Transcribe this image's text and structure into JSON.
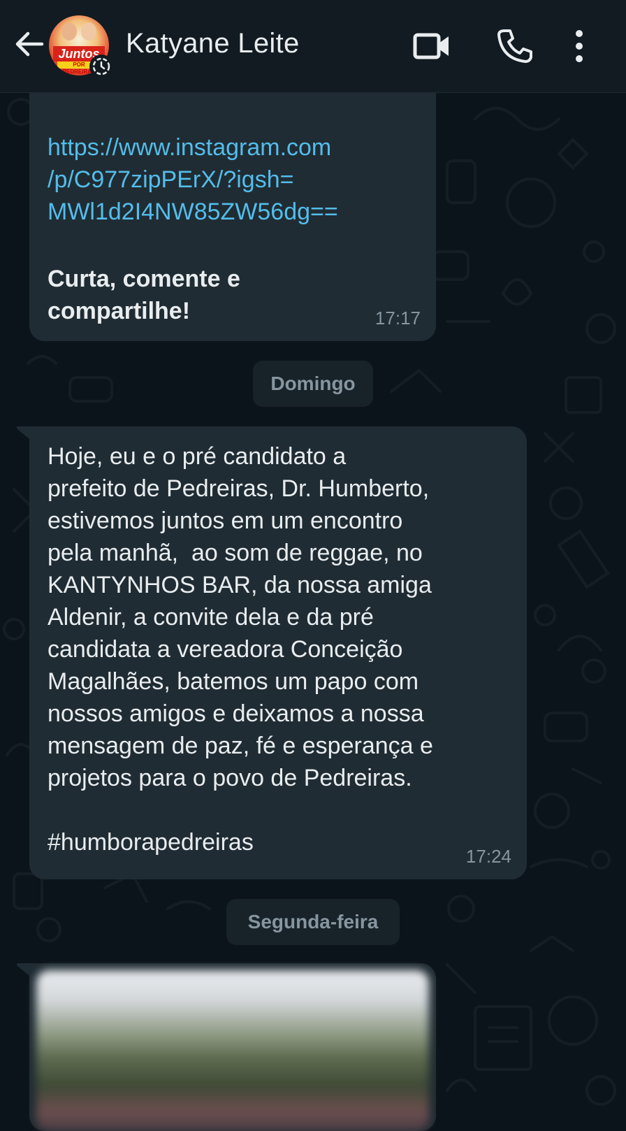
{
  "header": {
    "contact_name": "Katyane Leite",
    "avatar_text": "Juntos",
    "avatar_subtext": "POR PEDREIRAS",
    "icons": [
      "back-arrow-icon",
      "video-call-icon",
      "phone-icon",
      "more-vert-icon"
    ]
  },
  "messages": [
    {
      "link_lines": [
        "https://www.instagram.com",
        "/p/C977zipPErX/?igsh=",
        "MWl1d2I4NW85ZW56dg=="
      ],
      "bold_lines": [
        "Curta, comente e",
        "compartilhe!"
      ],
      "time": "17:17"
    },
    {
      "date_label": "Domingo"
    },
    {
      "lines": [
        "Hoje, eu e o pré candidato a",
        "prefeito de Pedreiras, Dr. Humberto,",
        "estivemos juntos em um encontro",
        "pela manhã,  ao som de reggae, no",
        "KANTYNHOS BAR, da nossa amiga",
        "Aldenir, a convite dela e da pré",
        "candidata a vereadora Conceição",
        "Magalhães, batemos um papo com",
        "nossos amigos e deixamos a nossa",
        "mensagem de paz, fé e esperança e",
        "projetos para o povo de Pedreiras."
      ],
      "hashtag": "#humborapedreiras",
      "time": "17:24"
    },
    {
      "date_label": "Segunda-feira"
    }
  ],
  "colors": {
    "background": "#0b141a",
    "header": "#111b21",
    "bubble": "#202c33",
    "link": "#53bdeb",
    "meta_text": "#8696a0"
  }
}
